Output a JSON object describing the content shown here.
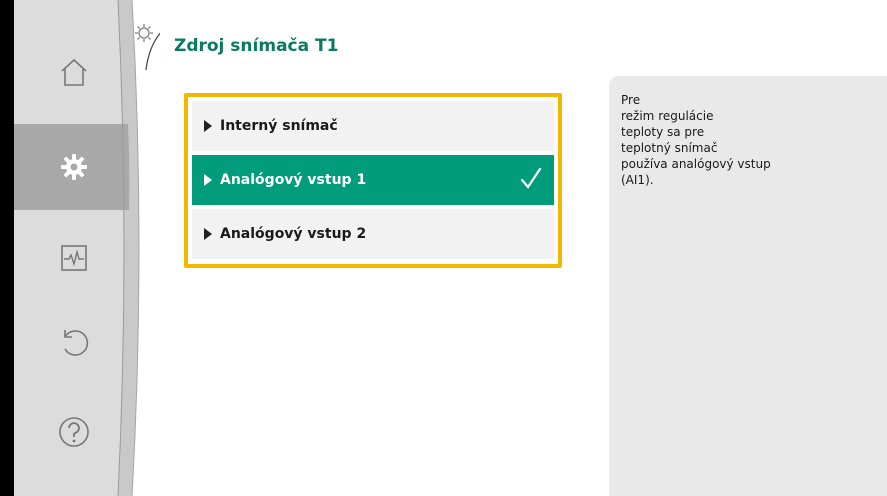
{
  "title": "Zdroj snímača T1",
  "nav": {
    "items": [
      {
        "icon": "home-icon"
      },
      {
        "icon": "gear-icon",
        "active": true
      },
      {
        "icon": "diagnostics-icon"
      },
      {
        "icon": "undo-icon"
      },
      {
        "icon": "help-icon"
      }
    ]
  },
  "options": [
    {
      "label": "Interný snímač",
      "selected": false
    },
    {
      "label": "Analógový vstup 1",
      "selected": true
    },
    {
      "label": "Analógový vstup 2",
      "selected": false
    }
  ],
  "info": {
    "lines": [
      "Pre",
      "režim regulácie",
      "teploty sa pre",
      "teplotný snímač",
      "používa analógový vstup",
      "(AI1)."
    ]
  },
  "colors": {
    "accent_green": "#009c7c",
    "title_green": "#0b7a60",
    "highlight_frame": "#f3b700",
    "nav_gray": "#dcdcdc",
    "nav_active": "#a8a8a8"
  }
}
